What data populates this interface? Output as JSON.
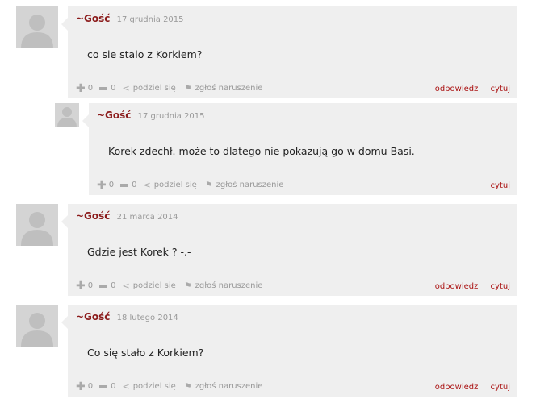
{
  "comments": [
    {
      "author": "~Gość",
      "date": "17 grudnia 2015",
      "text": "co sie stalo z Korkiem?",
      "plus": "0",
      "minus": "0",
      "share": "podziel się",
      "report": "zgłoś naruszenie",
      "reply": "odpowiedz",
      "quote": "cytuj"
    },
    {
      "author": "~Gość",
      "date": "17 grudnia 2015",
      "text": "Korek zdechł. może to dlatego nie pokazują go w domu Basi.",
      "plus": "0",
      "minus": "0",
      "share": "podziel się",
      "report": "zgłoś naruszenie",
      "quote": "cytuj"
    },
    {
      "author": "~Gość",
      "date": "21 marca 2014",
      "text": "Gdzie jest Korek ? -.-",
      "plus": "0",
      "minus": "0",
      "share": "podziel się",
      "report": "zgłoś naruszenie",
      "reply": "odpowiedz",
      "quote": "cytuj"
    },
    {
      "author": "~Gość",
      "date": "18 lutego 2014",
      "text": "Co się stało z Korkiem?",
      "plus": "0",
      "minus": "0",
      "share": "podziel się",
      "report": "zgłoś naruszenie",
      "reply": "odpowiedz",
      "quote": "cytuj"
    }
  ]
}
